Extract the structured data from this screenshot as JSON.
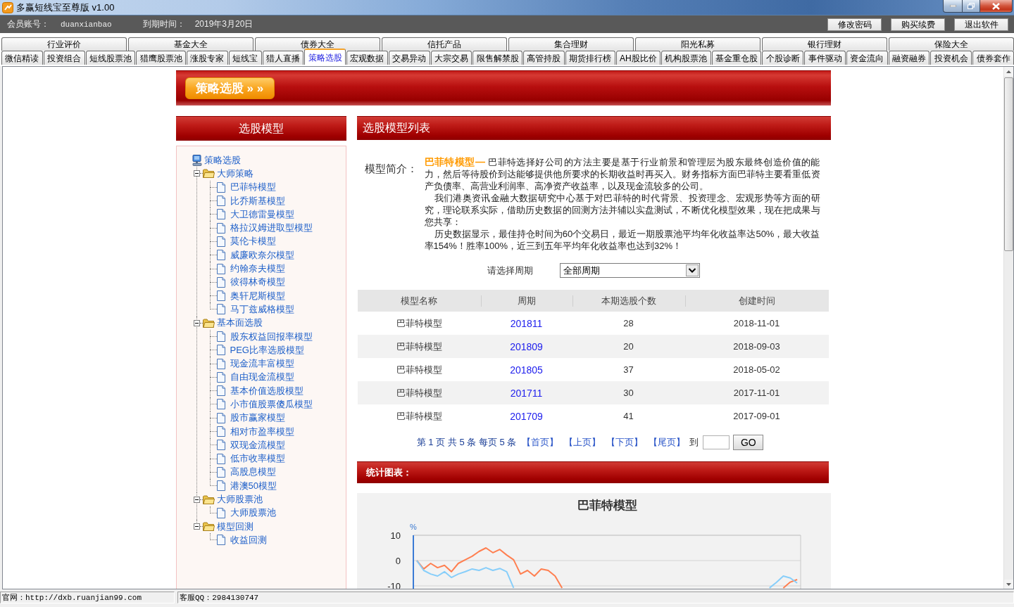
{
  "window": {
    "title": "多赢短线宝至尊版 v1.00"
  },
  "account_bar": {
    "member_label": "会员账号：",
    "member_value": "duanxianbao",
    "expiry_label": "到期时间：",
    "expiry_value": "2019年3月20日",
    "buttons": [
      "修改密码",
      "购买续费",
      "退出软件"
    ]
  },
  "tab_rows": [
    {
      "tabs": [
        {
          "label": "行业评价",
          "selected": false
        },
        {
          "label": "基金大全",
          "selected": false
        },
        {
          "label": "债券大全",
          "selected": false
        },
        {
          "label": "信托产品",
          "selected": false
        },
        {
          "label": "集合理财",
          "selected": false
        },
        {
          "label": "阳光私募",
          "selected": false
        },
        {
          "label": "银行理财",
          "selected": false
        },
        {
          "label": "保险大全",
          "selected": false
        }
      ]
    },
    {
      "tabs": [
        {
          "label": "微信精读",
          "selected": false
        },
        {
          "label": "投资组合",
          "selected": false
        },
        {
          "label": "短线股票池",
          "selected": false
        },
        {
          "label": "猎鹰股票池",
          "selected": false
        },
        {
          "label": "涨股专家",
          "selected": false
        },
        {
          "label": "短线宝",
          "selected": false
        },
        {
          "label": "猎人直播",
          "selected": false
        },
        {
          "label": "策略选股",
          "selected": true
        },
        {
          "label": "宏观数据",
          "selected": false
        },
        {
          "label": "交易异动",
          "selected": false
        },
        {
          "label": "大宗交易",
          "selected": false
        },
        {
          "label": "限售解禁股",
          "selected": false
        },
        {
          "label": "高管持股",
          "selected": false
        },
        {
          "label": "期货排行榜",
          "selected": false
        },
        {
          "label": "AH股比价",
          "selected": false
        },
        {
          "label": "机构股票池",
          "selected": false
        },
        {
          "label": "基金重仓股",
          "selected": false
        },
        {
          "label": "个股诊断",
          "selected": false
        },
        {
          "label": "事件驱动",
          "selected": false
        },
        {
          "label": "资金流向",
          "selected": false
        },
        {
          "label": "融资融券",
          "selected": false
        },
        {
          "label": "投资机会",
          "selected": false
        },
        {
          "label": "债券套作",
          "selected": false
        }
      ]
    }
  ],
  "banner": {
    "button": "策略选股 » »"
  },
  "sidebar": {
    "title": "选股模型",
    "tree": {
      "label": "策略选股",
      "children": [
        {
          "label": "大师策略",
          "expanded": true,
          "children": [
            {
              "label": "巴菲特模型"
            },
            {
              "label": "比乔斯基模型"
            },
            {
              "label": "大卫德雷曼模型"
            },
            {
              "label": "格拉汉姆进取型模型"
            },
            {
              "label": "莫伦卡模型"
            },
            {
              "label": "威廉欧奈尔模型"
            },
            {
              "label": "约翰奈夫模型"
            },
            {
              "label": "彼得林奇模型"
            },
            {
              "label": "奥轩尼斯模型"
            },
            {
              "label": "马丁兹威格模型"
            }
          ]
        },
        {
          "label": "基本面选股",
          "expanded": true,
          "children": [
            {
              "label": "股东权益回报率模型"
            },
            {
              "label": "PEG比率选股模型"
            },
            {
              "label": "现金流丰富模型"
            },
            {
              "label": "自由现金流模型"
            },
            {
              "label": "基本价值选股模型"
            },
            {
              "label": "小市值股票傻瓜模型"
            },
            {
              "label": "股市赢家模型"
            },
            {
              "label": "相对市盈率模型"
            },
            {
              "label": "双现金流模型"
            },
            {
              "label": "低市收率模型"
            },
            {
              "label": "高股息模型"
            },
            {
              "label": "港澳50模型"
            }
          ]
        },
        {
          "label": "大师股票池",
          "expanded": true,
          "children": [
            {
              "label": "大师股票池"
            }
          ]
        },
        {
          "label": "模型回测",
          "expanded": true,
          "children": [
            {
              "label": "收益回测"
            }
          ]
        }
      ]
    }
  },
  "main": {
    "title": "选股模型列表",
    "intro": {
      "label": "模型简介：",
      "paragraphs": [
        "**巴菲特模型—** 巴菲特选择好公司的方法主要是基于行业前景和管理层为股东最终创造价值的能力，然后等待股价到达能够提供他所要求的长期收益时再买入。财务指标方面巴菲特主要看重低资产负债率、高营业利润率、高净资产收益率，以及现金流较多的公司。",
        "我们港奥资讯金融大数据研究中心基于对巴菲特的时代背景、投资理念、宏观形势等方面的研究，理论联系实际，借助历史数据的回测方法并辅以实盘测试，不断优化模型效果，现在把成果与您共享：",
        "历史数据显示，最佳持仓时间为60个交易日，最近一期股票池平均年化收益率达50%，最大收益率154%！胜率100%，近三到五年平均年化收益率也达到32%！"
      ]
    },
    "period_filter": {
      "label": "请选择周期",
      "value": "全部周期"
    },
    "table": {
      "columns": [
        "模型名称",
        "周期",
        "本期选股个数",
        "创建时间"
      ],
      "rows": [
        {
          "name": "巴菲特模型",
          "period": "201811",
          "count": "28",
          "created": "2018-11-01"
        },
        {
          "name": "巴菲特模型",
          "period": "201809",
          "count": "20",
          "created": "2018-09-03"
        },
        {
          "name": "巴菲特模型",
          "period": "201805",
          "count": "37",
          "created": "2018-05-02"
        },
        {
          "name": "巴菲特模型",
          "period": "201711",
          "count": "30",
          "created": "2017-11-01"
        },
        {
          "name": "巴菲特模型",
          "period": "201709",
          "count": "41",
          "created": "2017-09-01"
        }
      ]
    },
    "pagination": {
      "summary": "第 1 页 共 5 条 每页 5 条",
      "links": [
        "【首页】",
        "【上页】",
        "【下页】",
        "【尾页】"
      ],
      "goto_label": "到",
      "go_button": "GO"
    },
    "chart_section": {
      "title": "统计图表：",
      "chart_data": {
        "type": "line",
        "title": "巴菲特模型",
        "ylabel": "%",
        "ylim": [
          -11,
          10
        ],
        "yticks": [
          10,
          0,
          -10
        ],
        "series": [
          {
            "color": "#ff7f50",
            "values": [
              0,
              -3.3,
              -1.1,
              -2.8,
              -1.9,
              -4.4,
              -1.1,
              0.3,
              1.7,
              3.6,
              5,
              3.1,
              4.4,
              2.2,
              0.3,
              -5.3,
              -3.9,
              -6.1,
              -3.3,
              -3.9,
              -6.1,
              -10.8,
              null,
              null,
              null,
              null,
              null,
              null,
              null,
              null,
              null,
              null,
              null,
              null,
              null,
              null,
              null,
              null,
              null,
              null,
              null,
              null,
              null,
              null,
              null,
              null,
              null,
              null,
              null,
              null,
              null,
              null,
              null,
              -10.8,
              -8.5,
              -7.5
            ]
          },
          {
            "color": "#87cefa",
            "values": [
              0,
              -3.9,
              -5.3,
              -6.1,
              -4.4,
              -6.7,
              -5.3,
              -4.4,
              -3.3,
              -3.9,
              -2.8,
              -3.9,
              -3.1,
              -4.4,
              -10.8,
              null,
              null,
              null,
              null,
              null,
              null,
              null,
              null,
              null,
              null,
              null,
              null,
              null,
              null,
              null,
              null,
              null,
              null,
              null,
              null,
              null,
              null,
              null,
              null,
              null,
              null,
              null,
              null,
              null,
              null,
              null,
              null,
              null,
              null,
              null,
              null,
              -10.8,
              -8.6,
              -6.1,
              -6.9,
              -8.9
            ]
          }
        ]
      }
    }
  },
  "status_bar": {
    "website": "官网：http://dxb.ruanjian99.com",
    "support": "客服QQ：2984130747"
  }
}
